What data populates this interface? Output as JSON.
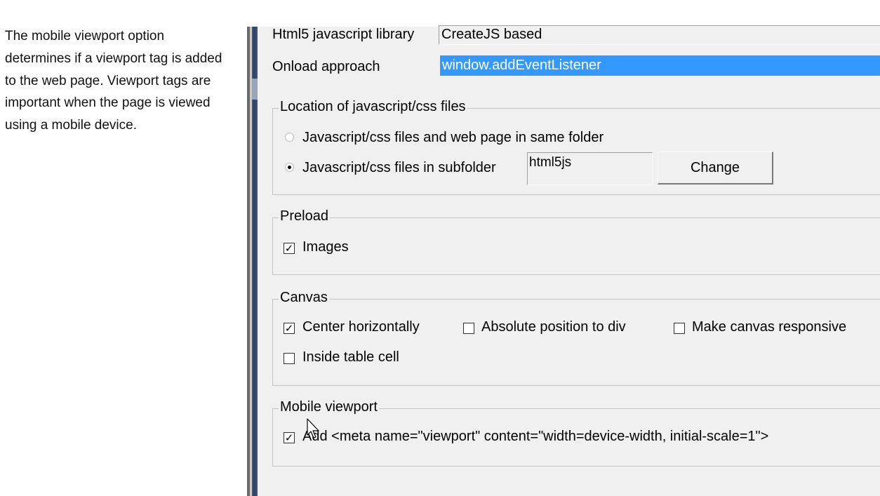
{
  "help": {
    "lines": [
      "The mobile viewport option",
      "determines if a viewport tag is added",
      "to the web page. Viewport tags are",
      "important when the page is viewed",
      "using a mobile device."
    ]
  },
  "settings": {
    "library_label": "Html5 javascript library",
    "library_value": "CreateJS based",
    "onload_label": "Onload approach",
    "onload_value": "window.addEventListener"
  },
  "location": {
    "title": "Location of javascript/css files",
    "option_same": "Javascript/css files and web page in same folder",
    "option_sub": "Javascript/css files in subfolder",
    "selected": "subfolder",
    "subfolder_value": "html5js",
    "change_label": "Change"
  },
  "preload": {
    "title": "Preload",
    "images_label": "Images",
    "images_checked": true
  },
  "canvas": {
    "title": "Canvas",
    "center_label": "Center horizontally",
    "center_checked": true,
    "absolute_label": "Absolute position to div",
    "absolute_checked": false,
    "responsive_label": "Make canvas responsive",
    "responsive_checked": false,
    "table_label": "Inside table cell",
    "table_checked": false
  },
  "mobile": {
    "title": "Mobile viewport",
    "add_label": "Add <meta name=\"viewport\" content=\"width=device-width, initial-scale=1\">",
    "add_checked": true
  },
  "colors": {
    "selection": "#3399ff",
    "panel": "#f0f0f0",
    "splitter": "#2c3e63"
  },
  "icons": {
    "checkmark": "check-mark-icon",
    "cursor": "mouse-pointer-icon"
  }
}
